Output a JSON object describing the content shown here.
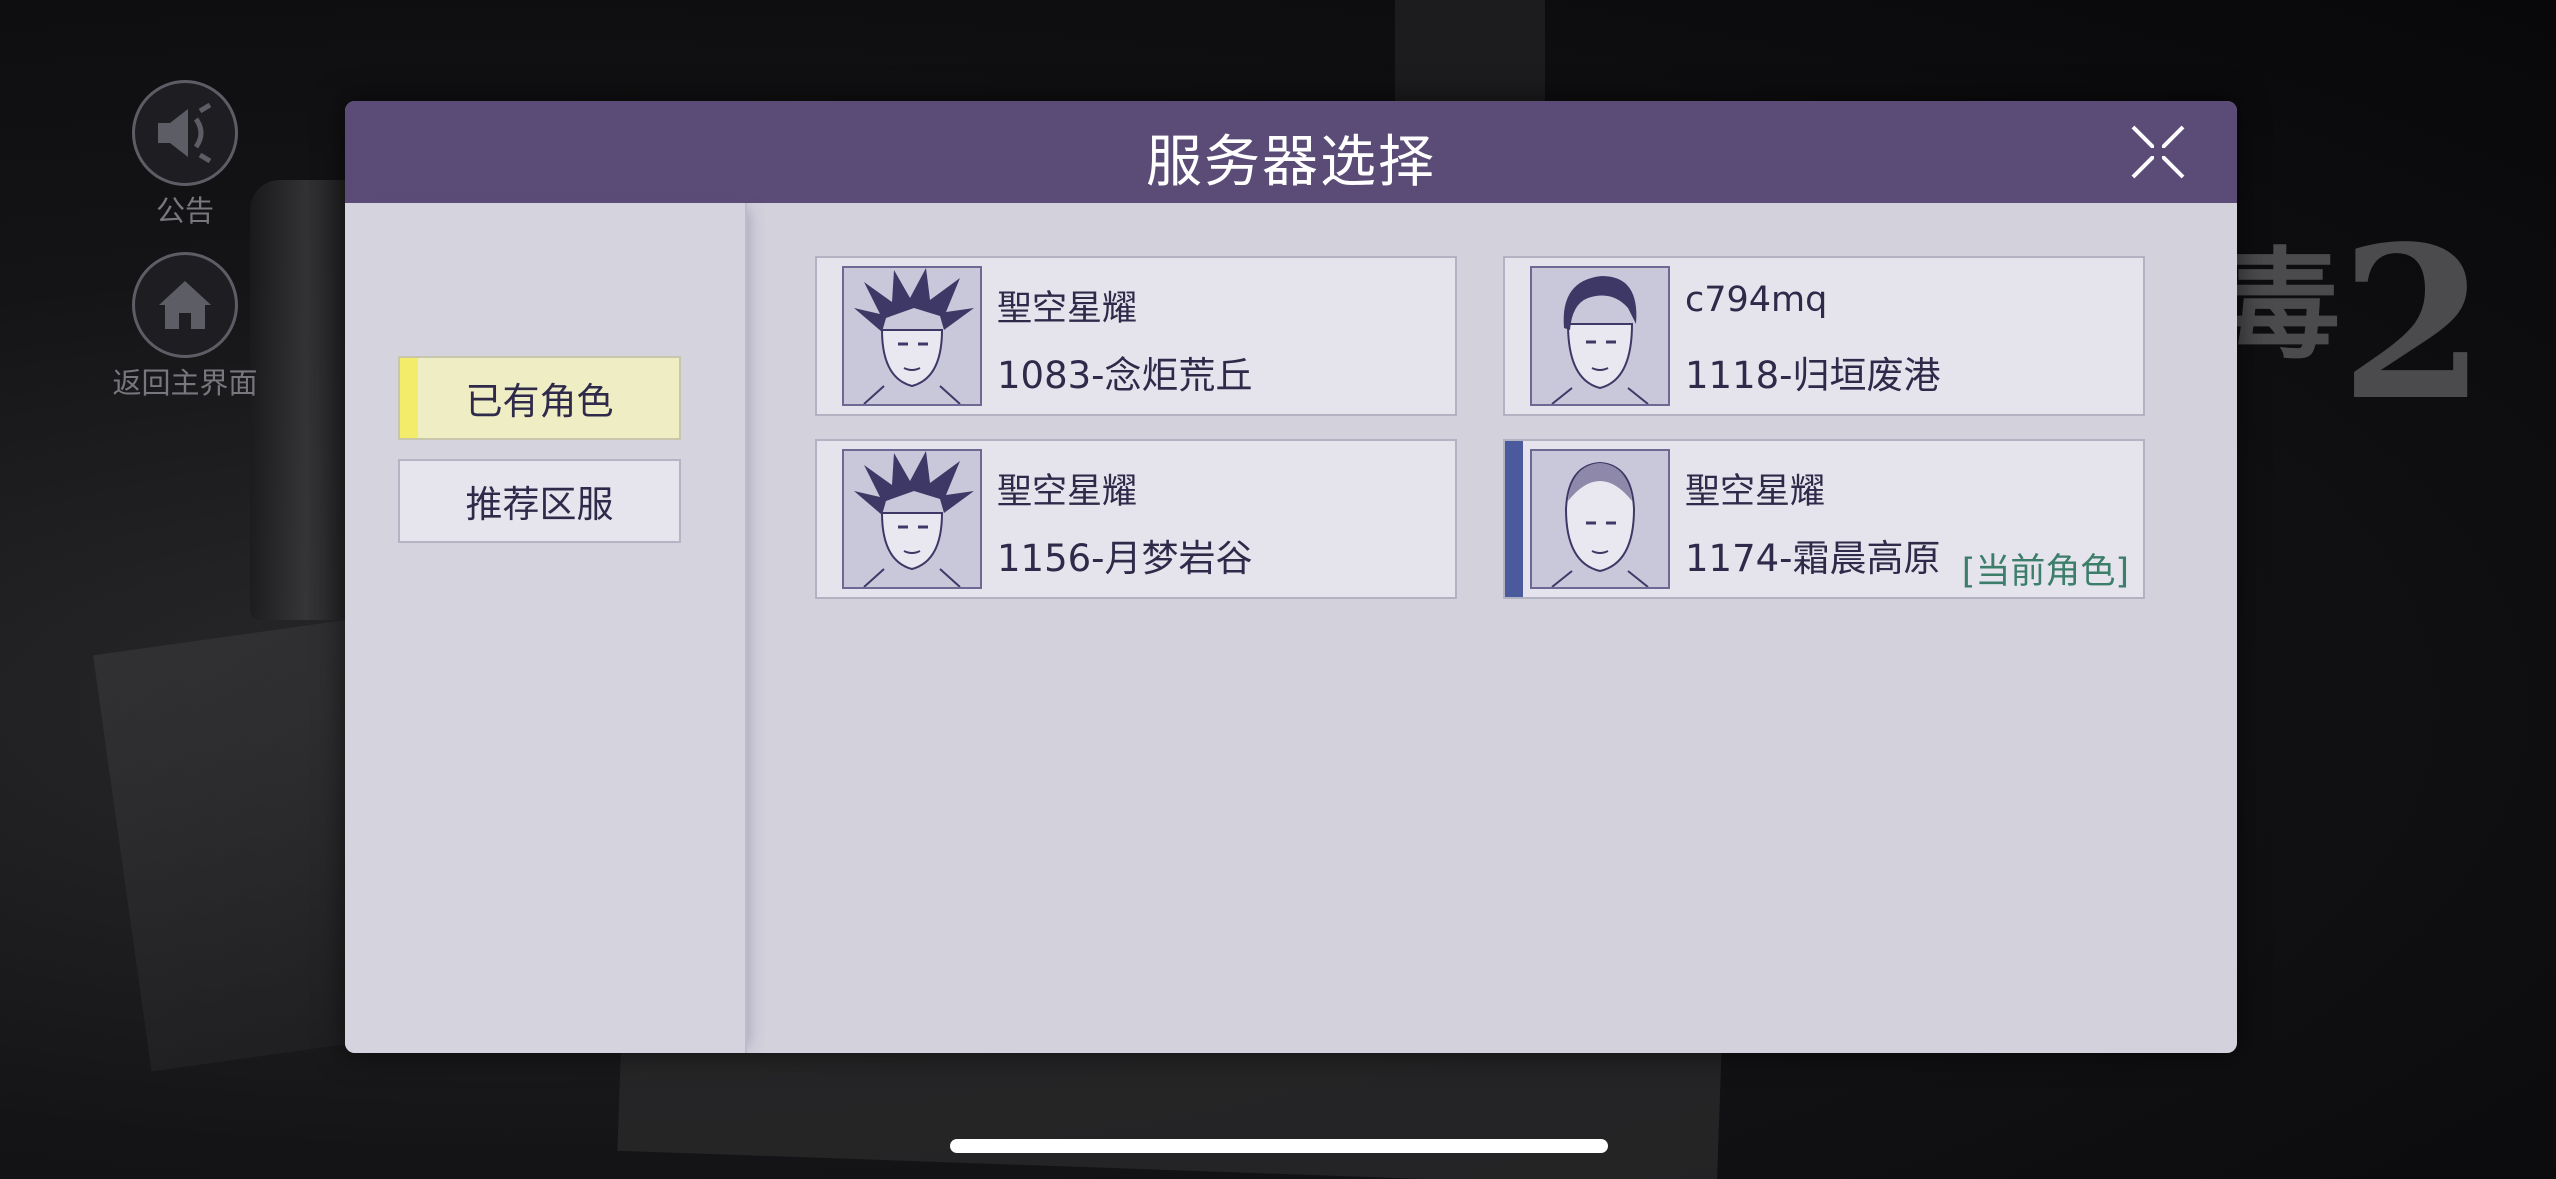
{
  "side_buttons": {
    "notice_label": "公告",
    "home_label": "返回主界面"
  },
  "background": {
    "title_small": "毒",
    "title_num": "2"
  },
  "dialog": {
    "title": "服务器选择",
    "tabs": [
      {
        "label": "已有角色",
        "active": true
      },
      {
        "label": "推荐区服",
        "active": false
      }
    ],
    "characters": [
      {
        "name": "聖空星耀",
        "server": "1083-念炬荒丘",
        "avatar": "spiky-hair-portrait-icon",
        "current": false
      },
      {
        "name": "c794mq",
        "server": "1118-归垣废港",
        "avatar": "slick-hair-portrait-icon",
        "current": false
      },
      {
        "name": "聖空星耀",
        "server": "1156-月梦岩谷",
        "avatar": "spiky-hair-portrait-icon",
        "current": false
      },
      {
        "name": "聖空星耀",
        "server": "1174-霜晨高原",
        "avatar": "buzzcut-portrait-icon",
        "current": true,
        "current_tag": "[当前角色]"
      }
    ]
  },
  "colors": {
    "header": "#5b4c77",
    "panel": "#d2d1dc",
    "active_tab": "#eeedc4",
    "active_tab_accent": "#f3ec6a",
    "current_accent": "#4a5a9c",
    "current_tag": "#3c7e6a"
  }
}
